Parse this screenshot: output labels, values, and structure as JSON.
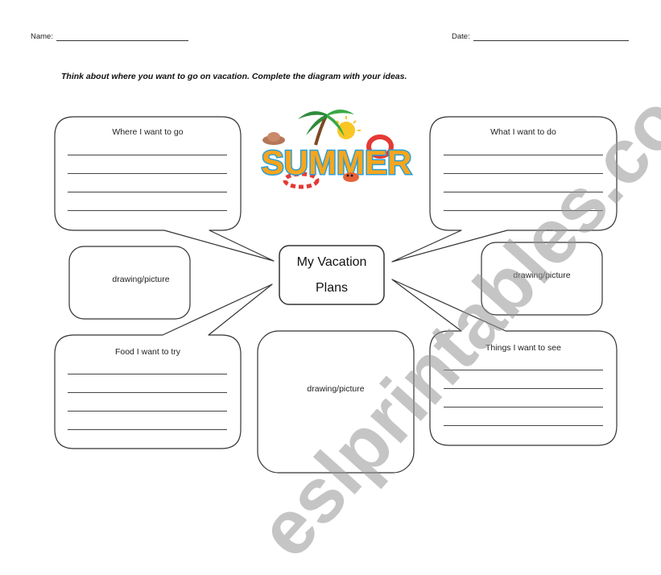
{
  "header": {
    "name_label": "Name:",
    "date_label": "Date:"
  },
  "instructions": "Think about where you want to go on vacation. Complete the diagram with your ideas.",
  "logo": {
    "text": "SUMMER",
    "icon": "summer-beach-logo",
    "colors": {
      "text": "#f7a51c",
      "outline": "#2a9fd8",
      "ring": "#e53935",
      "palm": "#2e8b3a",
      "sun": "#f9c623"
    }
  },
  "center": {
    "line1": "My Vacation",
    "line2": "Plans"
  },
  "boxes": {
    "where": {
      "title": "Where I want to go",
      "lines": 4
    },
    "what": {
      "title": "What I want to do",
      "lines": 4
    },
    "food": {
      "title": "Food I want to try",
      "lines": 4
    },
    "see": {
      "title": "Things I want to see",
      "lines": 4
    },
    "drawing_left": {
      "label": "drawing/picture"
    },
    "drawing_right": {
      "label": "drawing/picture"
    },
    "drawing_bottom": {
      "label": "drawing/picture"
    }
  },
  "watermark": "eslprintables.com"
}
